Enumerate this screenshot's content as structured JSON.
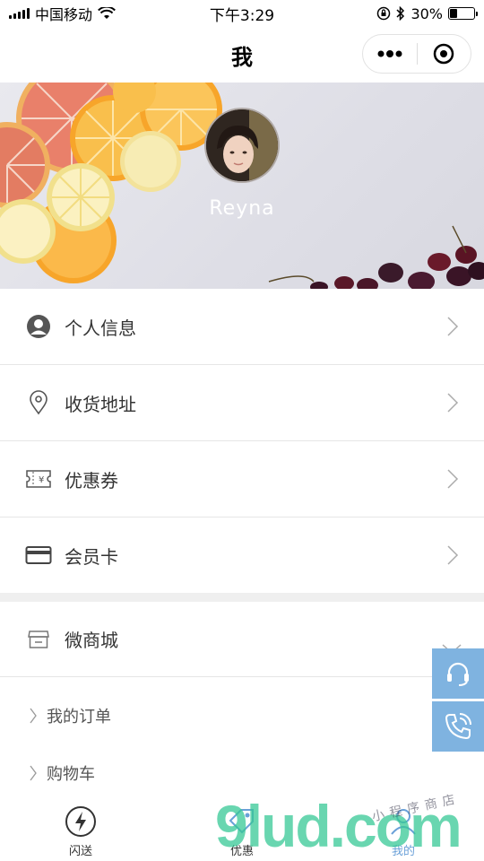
{
  "status_bar": {
    "carrier": "中国移动",
    "time": "下午3:29",
    "battery": "30%",
    "battery_level": 0.3
  },
  "nav": {
    "title": "我"
  },
  "profile": {
    "name": "Reyna"
  },
  "menu": [
    {
      "label": "个人信息",
      "icon": "user-icon"
    },
    {
      "label": "收货地址",
      "icon": "location-pin-icon"
    },
    {
      "label": "优惠券",
      "icon": "coupon-icon"
    },
    {
      "label": "会员卡",
      "icon": "card-icon"
    }
  ],
  "shop": {
    "label": "微商城",
    "icon": "store-icon",
    "sub_items": [
      "我的订单",
      "购物车"
    ]
  },
  "tabs": [
    {
      "label": "闪送",
      "icon": "lightning-icon"
    },
    {
      "label": "优惠",
      "icon": "tag-icon"
    },
    {
      "label": "我的",
      "icon": "person-icon"
    }
  ],
  "watermark": {
    "text": "9lud.com",
    "subtext": "小程序商店"
  },
  "colors": {
    "accent": "#7fb3e0",
    "text": "#333333",
    "divider": "#e6e6e6"
  }
}
